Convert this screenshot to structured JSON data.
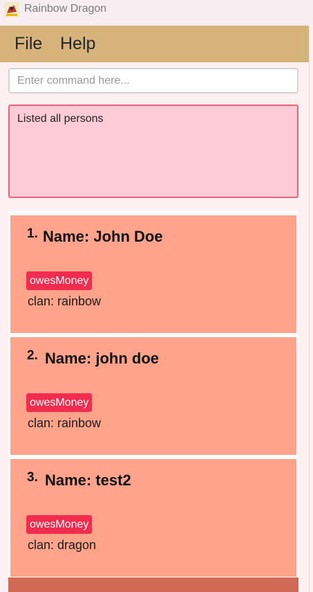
{
  "window": {
    "title": "Rainbow Dragon",
    "icon": "dragon-app-icon"
  },
  "menu": {
    "file_label": "File",
    "help_label": "Help"
  },
  "command": {
    "placeholder": "Enter command here...",
    "value": ""
  },
  "result": {
    "message": "Listed all persons"
  },
  "persons": [
    {
      "index": "1.",
      "name": "Name: John Doe",
      "tag": "owesMoney",
      "clan": "clan: rainbow"
    },
    {
      "index": "2.",
      "name": "Name: john doe",
      "tag": "owesMoney",
      "clan": "clan: rainbow"
    },
    {
      "index": "3.",
      "name": "Name: test2",
      "tag": "owesMoney",
      "clan": "clan: dragon"
    }
  ],
  "colors": {
    "menubar": "#d6b37b",
    "result_bg": "#ffcbd7",
    "result_border": "#ef5f79",
    "card_bg": "#ffa38a",
    "tag_bg": "#f22c4e"
  }
}
